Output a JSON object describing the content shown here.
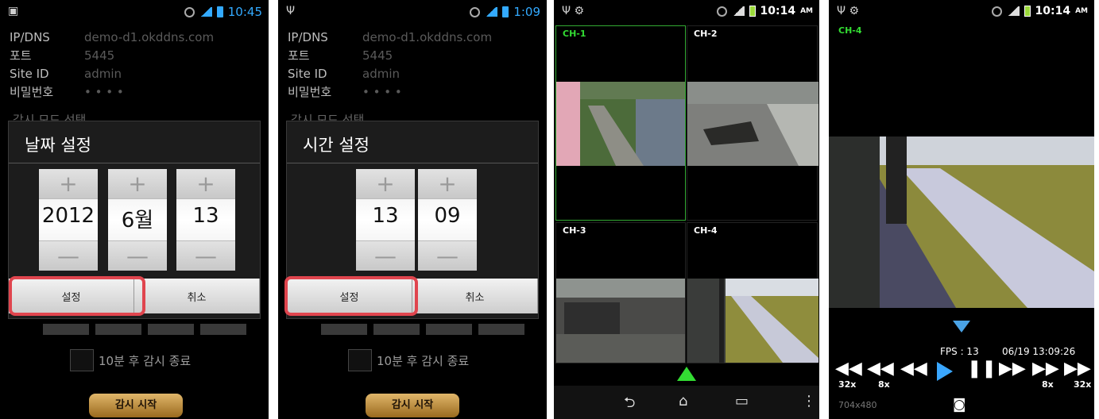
{
  "screen1": {
    "status_time": "10:45",
    "info": [
      {
        "key": "IP/DNS",
        "value": "demo-d1.okddns.com"
      },
      {
        "key": "포트",
        "value": "5445"
      },
      {
        "key": "Site ID",
        "value": "admin"
      },
      {
        "key": "비밀번호",
        "value": "• • • •"
      }
    ],
    "hidden_title": "감시 모드 선택",
    "dialog_title": "날짜 설정",
    "spinners": [
      {
        "value": "2012"
      },
      {
        "value": "6월"
      },
      {
        "value": "13"
      }
    ],
    "plus": "+",
    "minus": "—",
    "ok": "설정",
    "cancel": "취소",
    "auto_stop": "10분 후 감시 종료",
    "start": "감시 시작"
  },
  "screen2": {
    "status_time": "1:09",
    "info": [
      {
        "key": "IP/DNS",
        "value": "demo-d1.okddns.com"
      },
      {
        "key": "포트",
        "value": "5445"
      },
      {
        "key": "Site ID",
        "value": "admin"
      },
      {
        "key": "비밀번호",
        "value": "• • • •"
      }
    ],
    "hidden_title": "감시 모드 선택",
    "dialog_title": "시간 설정",
    "spinners": [
      {
        "value": "13"
      },
      {
        "value": "09"
      }
    ],
    "plus": "+",
    "minus": "—",
    "ok": "설정",
    "cancel": "취소",
    "auto_stop": "10분 후 감시 종료",
    "start": "감시 시작"
  },
  "screen3": {
    "status_time": "10:14",
    "status_ampm": "AM",
    "channels": [
      "CH-1",
      "CH-2",
      "CH-3",
      "CH-4"
    ],
    "nav_back": "⮌",
    "nav_home": "⌂",
    "nav_recent": "▭",
    "nav_menu": "⋮"
  },
  "screen4": {
    "status_time": "10:14",
    "status_ampm": "AM",
    "channel": "CH-4",
    "fps": "FPS : 13",
    "timestamp": "06/19 13:09:26",
    "speeds": {
      "rw32": "32x",
      "rw8": "8x",
      "ff8": "8x",
      "ff32": "32x"
    },
    "resolution": "704x480",
    "accent": "#3aa7ff"
  }
}
